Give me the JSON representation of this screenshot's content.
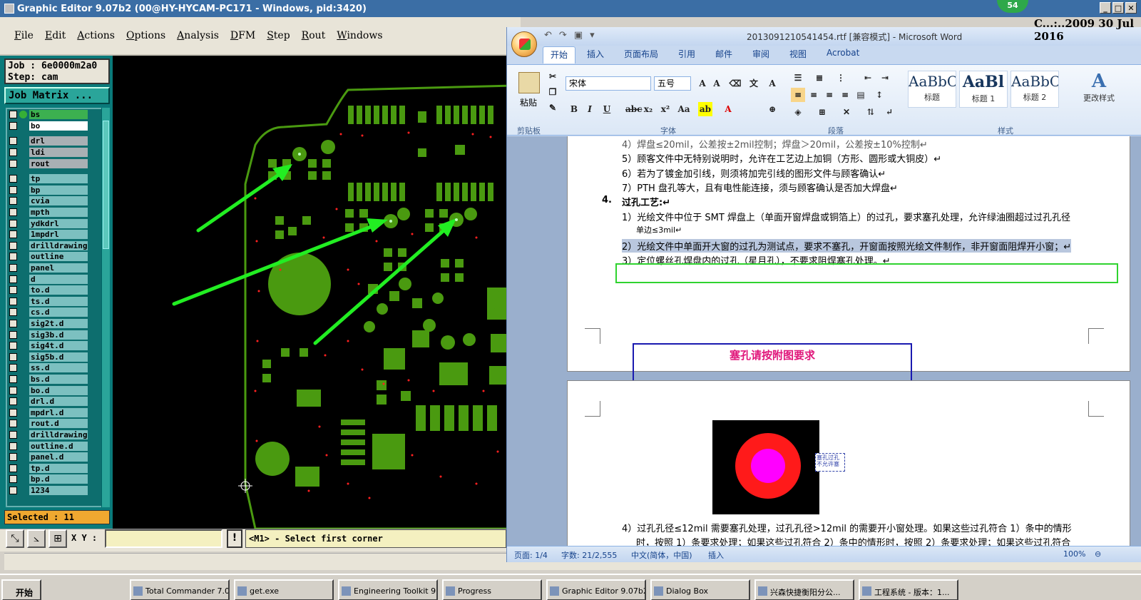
{
  "graphic_editor": {
    "title": "Graphic Editor 9.07b2 (00@HY-HYCAM-PC171 - Windows, pid:3420)",
    "menu": [
      "File",
      "Edit",
      "Actions",
      "Options",
      "Analysis",
      "DFM",
      "Step",
      "Rout",
      "Windows"
    ],
    "job_line": "Job : 6e0000m2a0",
    "step_line": "Step: cam",
    "job_matrix_button": "Job Matrix ...",
    "layers_group1": [
      "bs",
      "bo"
    ],
    "layers_group2": [
      "drl",
      "ldi",
      "rout"
    ],
    "layers_group3": [
      "tp",
      "bp",
      "cvia",
      "mpth",
      "ydkdrl",
      "1mpdrl",
      "drilldrawing",
      "outline",
      "panel",
      "d",
      "to.d",
      "ts.d",
      "cs.d",
      "sig2t.d",
      "sig3b.d",
      "sig4t.d",
      "sig5b.d",
      "ss.d",
      "bs.d",
      "bo.d",
      "drl.d",
      "mpdrl.d",
      "rout.d",
      "drilldrawing",
      "outline.d",
      "panel.d",
      "tp.d",
      "bp.d",
      "1234"
    ],
    "selected_status": "Selected : 11",
    "xy_label": "X Y :",
    "xy_value": "",
    "warn_button": "!",
    "prompt": "<M1> - Select first corner",
    "colors": {
      "canvas": "#000000",
      "copper": "#4a9a10",
      "arrow": "#22ee22",
      "drill": "#ff2020"
    }
  },
  "badge": "54",
  "corner_text": "C...:..2009 30 Jul 2016",
  "word": {
    "title": "2013091210541454.rtf [兼容模式] - Microsoft Word",
    "tabs": [
      "开始",
      "插入",
      "页面布局",
      "引用",
      "邮件",
      "审阅",
      "视图",
      "Acrobat"
    ],
    "ribbon": {
      "paste": "粘贴",
      "clipboard": "剪贴板",
      "font_name": "宋体",
      "font_size": "五号",
      "font_group": "字体",
      "paragraph_group": "段落",
      "styles_group": "样式",
      "styles": [
        {
          "preview": "AaBbC",
          "name": "标题"
        },
        {
          "preview": "AaBl",
          "name": "标题 1"
        },
        {
          "preview": "AaBbC",
          "name": "标题 2"
        }
      ],
      "change_styles": "更改样式"
    },
    "doc_lines": [
      "4）焊盘≤20mil，公差按±2mil控制；焊盘＞20mil，公差按±10%控制↵",
      "5）顾客文件中无特别说明时，允许在工艺边上加铜（方形、圆形或大铜皮）↵",
      "6）若为了镀金加引线，则须将加完引线的图形文件与顾客确认↵",
      "7）PTH 盘孔等大，且有电性能连接，须与顾客确认是否加大焊盘↵",
      "过孔工艺:↵",
      "1）光绘文件中位于 SMT 焊盘上（单面开窗焊盘或铜箔上）的过孔，要求塞孔处理，允许绿油圈超过过孔孔径",
      "单边≤3mil↵",
      "2）光绘文件中单面开大窗的过孔为测试点，要求不塞孔，开窗面按照光绘文件制作，非开窗面阻焊开小窗；↵",
      "3）定位螺丝孔焊盘内的过孔（星月孔），不要求阻焊塞孔处理。↵",
      "4）过孔孔径≤12mil 需要塞孔处理，过孔孔径>12mil 的需要开小窗处理。如果这些过孔符合 1）条中的情形",
      "时，按照 1）条要求处理；如果这些过孔符合 2）条中的情形时，按照 2）条要求处理；如果这些过孔符合"
    ],
    "section_number": "4.",
    "box_text": "塞孔请按附图要求",
    "image_note": "塞孔过孔 不允许塞",
    "status": {
      "page": "页面: 1/4",
      "words": "字数: 21/2,555",
      "lang": "中文(简体，中国)",
      "mode": "插入",
      "zoom": "100%"
    }
  },
  "taskbar": {
    "start": "开始",
    "tasks": [
      "Total Commander 7.0...",
      "get.exe",
      "Engineering Toolkit 9...",
      "Progress",
      "Graphic Editor 9.07b2...",
      "Dialog Box",
      "兴森快捷衡阳分公...",
      "工程系统 - 版本：1..."
    ]
  }
}
